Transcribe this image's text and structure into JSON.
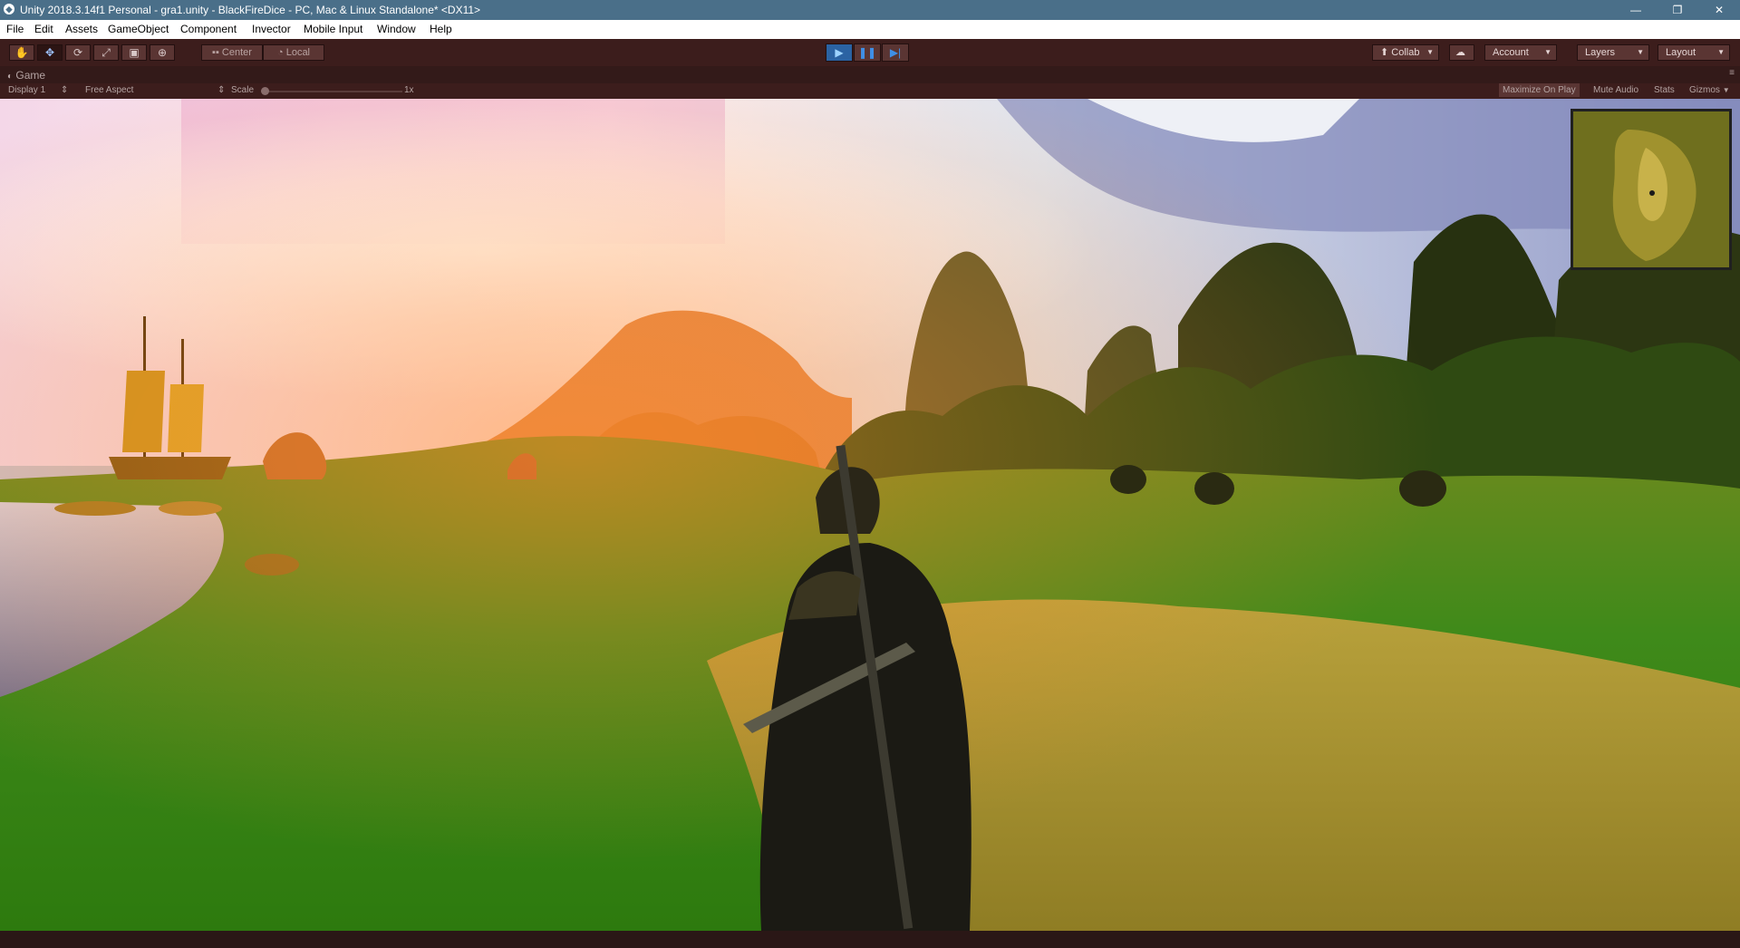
{
  "window": {
    "title": "Unity 2018.3.14f1 Personal - gra1.unity - BlackFireDice - PC, Mac & Linux Standalone* <DX11>",
    "minimize_glyph": "—",
    "restore_glyph": "❐",
    "close_glyph": "✕"
  },
  "menu": {
    "items": [
      "File",
      "Edit",
      "Assets",
      "GameObject",
      "Component",
      "Invector",
      "Mobile Input",
      "Window",
      "Help"
    ]
  },
  "toolbar": {
    "transform_tools": [
      {
        "name": "hand-tool",
        "icon": "hand-icon",
        "glyph": "✋"
      },
      {
        "name": "move-tool",
        "icon": "move-icon",
        "glyph": "✥",
        "active": true
      },
      {
        "name": "rotate-tool",
        "icon": "rotate-icon",
        "glyph": "⟳"
      },
      {
        "name": "scale-tool",
        "icon": "scale-icon",
        "glyph": "⤢"
      },
      {
        "name": "rect-tool",
        "icon": "rect-icon",
        "glyph": "▣"
      },
      {
        "name": "transform-tool",
        "icon": "transform-icon",
        "glyph": "⊕"
      }
    ],
    "pivot_mode": "Center",
    "pivot_rotation": "Local",
    "play_state": "playing",
    "collab_label": "Collab",
    "account_label": "Account",
    "layers_label": "Layers",
    "layout_label": "Layout"
  },
  "game_view": {
    "tab_label": "Game",
    "display": "Display 1",
    "aspect": "Free Aspect",
    "scale_label": "Scale",
    "scale_value": "1x",
    "maximize_on_play": "Maximize On Play",
    "maximize_on_play_enabled": true,
    "mute_audio": "Mute Audio",
    "stats": "Stats",
    "gizmos": "Gizmos"
  },
  "colors": {
    "titlebar": "#4a6f89",
    "editor_tint": "#3c1d1c",
    "play_active": "#2b63a3"
  }
}
